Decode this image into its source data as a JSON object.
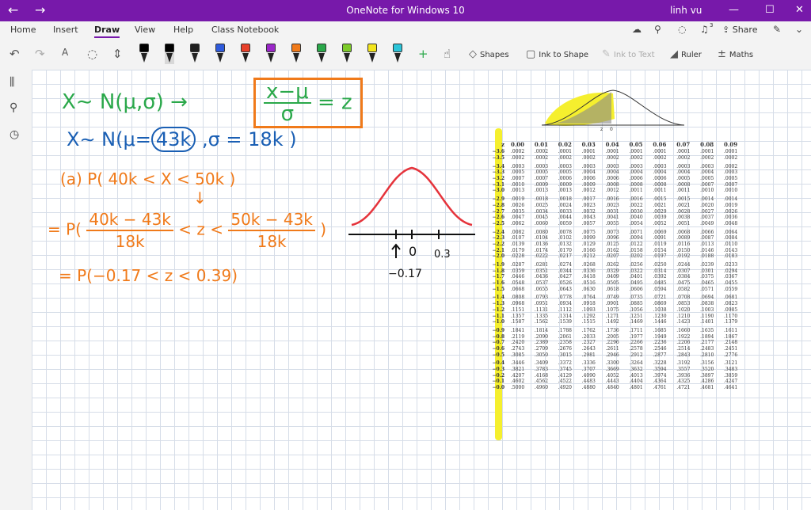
{
  "window": {
    "title": "OneNote for Windows 10",
    "user": "linh vu",
    "back_icon": "←",
    "forward_icon": "→",
    "minimize": "—",
    "maximize": "☐",
    "close": "✕"
  },
  "ribbon": {
    "tabs": [
      "Home",
      "Insert",
      "Draw",
      "View",
      "Help",
      "Class Notebook"
    ],
    "active_tab": "Draw",
    "share_label": "Share",
    "notification_count": "3"
  },
  "toolbar": {
    "shapes_label": "Shapes",
    "ink_to_shape_label": "Ink to Shape",
    "ink_to_text_label": "Ink to Text",
    "ruler_label": "Ruler",
    "maths_label": "Maths",
    "pens": [
      {
        "color": "#000000",
        "type": "highlighter"
      },
      {
        "color": "#000000",
        "type": "pen",
        "selected": true
      },
      {
        "color": "#1f1f1f",
        "type": "pen"
      },
      {
        "color": "#2f5bdc",
        "type": "pen"
      },
      {
        "color": "#e8402a",
        "type": "pen"
      },
      {
        "color": "#9a27c8",
        "type": "pen"
      },
      {
        "color": "#f07a1a",
        "type": "pen"
      },
      {
        "color": "#2aa84a",
        "type": "pen"
      },
      {
        "color": "#7dcb2a",
        "type": "highlighter"
      },
      {
        "color": "#f3e51d",
        "type": "highlighter"
      },
      {
        "color": "#2bc4d8",
        "type": "highlighter"
      }
    ],
    "add_pen": "+"
  },
  "notes": {
    "line1_left": "X∼ N(μ,σ) →",
    "line1_num": "x−μ",
    "line1_den": "σ",
    "line1_right": "= z",
    "line2_prefix": "X∼ N(μ=",
    "line2_mu": "43k",
    "line2_suffix": ",σ = 18k )",
    "line3": "(a) P( 40k < X < 50k )",
    "arrow_down": "↓",
    "line4_prefix": "= P(",
    "line4_num1": "40k − 43k",
    "line4_den1": "18k",
    "line4_mid": "< z <",
    "line4_num2": "50k − 43k",
    "line4_den2": "18k",
    "line4_suffix": ")",
    "line5": "= P(−0.17 < z < 0.39)",
    "axis_zero": "0",
    "axis_right": "0.3",
    "axis_left": "−0.17",
    "curve_color": "#e5333b"
  },
  "ztable": {
    "header": [
      "z",
      "0.00",
      "0.01",
      "0.02",
      "0.03",
      "0.04",
      "0.05",
      "0.06",
      "0.07",
      "0.08",
      "0.09"
    ],
    "rows": [
      [
        "−3.6",
        ".0002",
        ".0002",
        ".0001",
        ".0001",
        ".0001",
        ".0001",
        ".0001",
        ".0001",
        ".0001",
        ".0001"
      ],
      [
        "−3.5",
        ".0002",
        ".0002",
        ".0002",
        ".0002",
        ".0002",
        ".0002",
        ".0002",
        ".0002",
        ".0002",
        ".0002"
      ],
      [
        "−3.4",
        ".0003",
        ".0003",
        ".0003",
        ".0003",
        ".0003",
        ".0003",
        ".0003",
        ".0003",
        ".0003",
        ".0002"
      ],
      [
        "−3.3",
        ".0005",
        ".0005",
        ".0005",
        ".0004",
        ".0004",
        ".0004",
        ".0004",
        ".0004",
        ".0004",
        ".0003"
      ],
      [
        "−3.2",
        ".0007",
        ".0007",
        ".0006",
        ".0006",
        ".0006",
        ".0006",
        ".0006",
        ".0005",
        ".0005",
        ".0005"
      ],
      [
        "−3.1",
        ".0010",
        ".0009",
        ".0009",
        ".0009",
        ".0008",
        ".0008",
        ".0008",
        ".0008",
        ".0007",
        ".0007"
      ],
      [
        "−3.0",
        ".0013",
        ".0013",
        ".0013",
        ".0012",
        ".0012",
        ".0011",
        ".0011",
        ".0011",
        ".0010",
        ".0010"
      ],
      [
        "−2.9",
        ".0019",
        ".0018",
        ".0018",
        ".0017",
        ".0016",
        ".0016",
        ".0015",
        ".0015",
        ".0014",
        ".0014"
      ],
      [
        "−2.8",
        ".0026",
        ".0025",
        ".0024",
        ".0023",
        ".0023",
        ".0022",
        ".0021",
        ".0021",
        ".0020",
        ".0019"
      ],
      [
        "−2.7",
        ".0035",
        ".0034",
        ".0033",
        ".0032",
        ".0031",
        ".0030",
        ".0029",
        ".0028",
        ".0027",
        ".0026"
      ],
      [
        "−2.6",
        ".0047",
        ".0045",
        ".0044",
        ".0043",
        ".0041",
        ".0040",
        ".0039",
        ".0038",
        ".0037",
        ".0036"
      ],
      [
        "−2.5",
        ".0062",
        ".0060",
        ".0059",
        ".0057",
        ".0055",
        ".0054",
        ".0052",
        ".0051",
        ".0049",
        ".0048"
      ],
      [
        "−2.4",
        ".0082",
        ".0080",
        ".0078",
        ".0075",
        ".0073",
        ".0071",
        ".0069",
        ".0068",
        ".0066",
        ".0064"
      ],
      [
        "−2.3",
        ".0107",
        ".0104",
        ".0102",
        ".0099",
        ".0096",
        ".0094",
        ".0091",
        ".0089",
        ".0087",
        ".0084"
      ],
      [
        "−2.2",
        ".0139",
        ".0136",
        ".0132",
        ".0129",
        ".0125",
        ".0122",
        ".0119",
        ".0116",
        ".0113",
        ".0110"
      ],
      [
        "−2.1",
        ".0179",
        ".0174",
        ".0170",
        ".0166",
        ".0162",
        ".0158",
        ".0154",
        ".0150",
        ".0146",
        ".0143"
      ],
      [
        "−2.0",
        ".0228",
        ".0222",
        ".0217",
        ".0212",
        ".0207",
        ".0202",
        ".0197",
        ".0192",
        ".0188",
        ".0183"
      ],
      [
        "−1.9",
        ".0287",
        ".0281",
        ".0274",
        ".0268",
        ".0262",
        ".0256",
        ".0250",
        ".0244",
        ".0239",
        ".0233"
      ],
      [
        "−1.8",
        ".0359",
        ".0351",
        ".0344",
        ".0336",
        ".0329",
        ".0322",
        ".0314",
        ".0307",
        ".0301",
        ".0294"
      ],
      [
        "−1.7",
        ".0446",
        ".0436",
        ".0427",
        ".0418",
        ".0409",
        ".0401",
        ".0392",
        ".0384",
        ".0375",
        ".0367"
      ],
      [
        "−1.6",
        ".0548",
        ".0537",
        ".0526",
        ".0516",
        ".0505",
        ".0495",
        ".0485",
        ".0475",
        ".0465",
        ".0455"
      ],
      [
        "−1.5",
        ".0668",
        ".0655",
        ".0643",
        ".0630",
        ".0618",
        ".0606",
        ".0594",
        ".0582",
        ".0571",
        ".0559"
      ],
      [
        "−1.4",
        ".0808",
        ".0793",
        ".0778",
        ".0764",
        ".0749",
        ".0735",
        ".0721",
        ".0708",
        ".0694",
        ".0681"
      ],
      [
        "−1.3",
        ".0968",
        ".0951",
        ".0934",
        ".0918",
        ".0901",
        ".0885",
        ".0869",
        ".0853",
        ".0838",
        ".0823"
      ],
      [
        "−1.2",
        ".1151",
        ".1131",
        ".1112",
        ".1093",
        ".1075",
        ".1056",
        ".1038",
        ".1020",
        ".1003",
        ".0985"
      ],
      [
        "−1.1",
        ".1357",
        ".1335",
        ".1314",
        ".1292",
        ".1271",
        ".1251",
        ".1230",
        ".1210",
        ".1190",
        ".1170"
      ],
      [
        "−1.0",
        ".1587",
        ".1562",
        ".1539",
        ".1515",
        ".1492",
        ".1469",
        ".1446",
        ".1423",
        ".1401",
        ".1379"
      ],
      [
        "−0.9",
        ".1841",
        ".1814",
        ".1788",
        ".1762",
        ".1736",
        ".1711",
        ".1685",
        ".1660",
        ".1635",
        ".1611"
      ],
      [
        "−0.8",
        ".2119",
        ".2090",
        ".2061",
        ".2033",
        ".2005",
        ".1977",
        ".1949",
        ".1922",
        ".1894",
        ".1867"
      ],
      [
        "−0.7",
        ".2420",
        ".2389",
        ".2358",
        ".2327",
        ".2296",
        ".2266",
        ".2236",
        ".2206",
        ".2177",
        ".2148"
      ],
      [
        "−0.6",
        ".2743",
        ".2709",
        ".2676",
        ".2643",
        ".2611",
        ".2578",
        ".2546",
        ".2514",
        ".2483",
        ".2451"
      ],
      [
        "−0.5",
        ".3085",
        ".3050",
        ".3015",
        ".2981",
        ".2946",
        ".2912",
        ".2877",
        ".2843",
        ".2810",
        ".2776"
      ],
      [
        "−0.4",
        ".3446",
        ".3409",
        ".3372",
        ".3336",
        ".3300",
        ".3264",
        ".3228",
        ".3192",
        ".3156",
        ".3121"
      ],
      [
        "−0.3",
        ".3821",
        ".3783",
        ".3745",
        ".3707",
        ".3669",
        ".3632",
        ".3594",
        ".3557",
        ".3520",
        ".3483"
      ],
      [
        "−0.2",
        ".4207",
        ".4168",
        ".4129",
        ".4090",
        ".4052",
        ".4013",
        ".3974",
        ".3936",
        ".3897",
        ".3859"
      ],
      [
        "−0.1",
        ".4602",
        ".4562",
        ".4522",
        ".4483",
        ".4443",
        ".4404",
        ".4364",
        ".4325",
        ".4286",
        ".4247"
      ],
      [
        "−0.0",
        ".5000",
        ".4960",
        ".4920",
        ".4880",
        ".4840",
        ".4801",
        ".4761",
        ".4721",
        ".4681",
        ".4641"
      ]
    ],
    "curve_label_z": "z",
    "curve_label_0": "0",
    "highlight_color": "#f5ef2e"
  }
}
